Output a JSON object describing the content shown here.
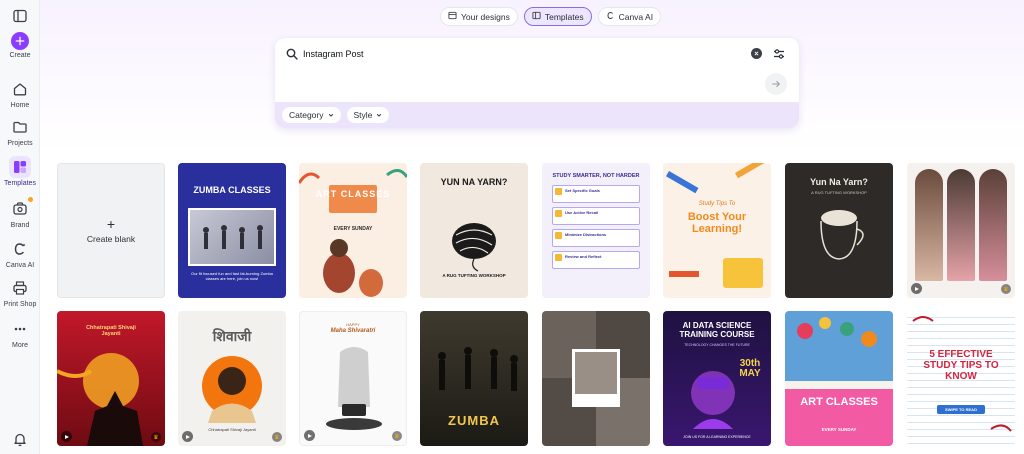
{
  "sidebar": {
    "items": [
      {
        "label": "",
        "icon": "panel-toggle-icon"
      },
      {
        "label": "Create",
        "icon": "plus-icon"
      },
      {
        "label": "Home",
        "icon": "home-icon"
      },
      {
        "label": "Projects",
        "icon": "folder-icon"
      },
      {
        "label": "Templates",
        "icon": "templates-icon"
      },
      {
        "label": "Brand",
        "icon": "brand-icon"
      },
      {
        "label": "Canva AI",
        "icon": "canva-ai-icon"
      },
      {
        "label": "Print Shop",
        "icon": "print-icon"
      },
      {
        "label": "More",
        "icon": "more-dots-icon"
      },
      {
        "label": "",
        "icon": "bell-icon"
      }
    ]
  },
  "tabs": [
    {
      "label": "Your designs",
      "icon": "design-icon",
      "active": false
    },
    {
      "label": "Templates",
      "icon": "template-icon",
      "active": true
    },
    {
      "label": "Canva AI",
      "icon": "canva-ai-icon",
      "active": false
    }
  ],
  "search": {
    "value": "Instagram Post",
    "filters": [
      {
        "label": "Category"
      },
      {
        "label": "Style"
      }
    ]
  },
  "create_blank_label": "Create blank",
  "templates_row1": [
    {
      "title": "ZUMBA CLASSES",
      "text": "Our fit focused fun and fast fat-burning Zumba classes are here, join us now!"
    },
    {
      "title": "ART CLASSES",
      "text": "EVERY SUNDAY"
    },
    {
      "title": "YUN NA YARN?",
      "text": "A RUG TUFTING WORKSHOP"
    },
    {
      "title": "STUDY SMARTER, NOT HARDER",
      "items": [
        "Set Specific Goals",
        "Use Active Recall",
        "Minimize Distractions",
        "Review and Reflect"
      ]
    },
    {
      "title": "Boost Your Learning!",
      "text": "Study Tips To"
    },
    {
      "title": "Yun Na Yarn?",
      "text": "A RUG TUFTING WORKSHOP"
    },
    {
      "title": "",
      "text": ""
    }
  ],
  "templates_row2": [
    {
      "title": "Chhatrapati Shivaji Jayanti",
      "text": ""
    },
    {
      "title": "शिवाजी",
      "text": "Chhatrapati Shivaji Jayanti"
    },
    {
      "title": "Maha Shivaratri",
      "text": "HAPPY"
    },
    {
      "title": "ZUMBA",
      "text": ""
    },
    {
      "title": "",
      "text": ""
    },
    {
      "title": "AI DATA SCIENCE TRAINING COURSE",
      "text": "TECHNOLOGY CHANGES THE FUTURE",
      "date": "30th MAY",
      "extra": "JOIN US FOR A LEARNING EXPERIENCE"
    },
    {
      "title": "ART CLASSES",
      "text": "EVERY SUNDAY"
    },
    {
      "title": "5 EFFECTIVE STUDY TIPS TO KNOW",
      "text": "SWIPE TO READ"
    }
  ]
}
